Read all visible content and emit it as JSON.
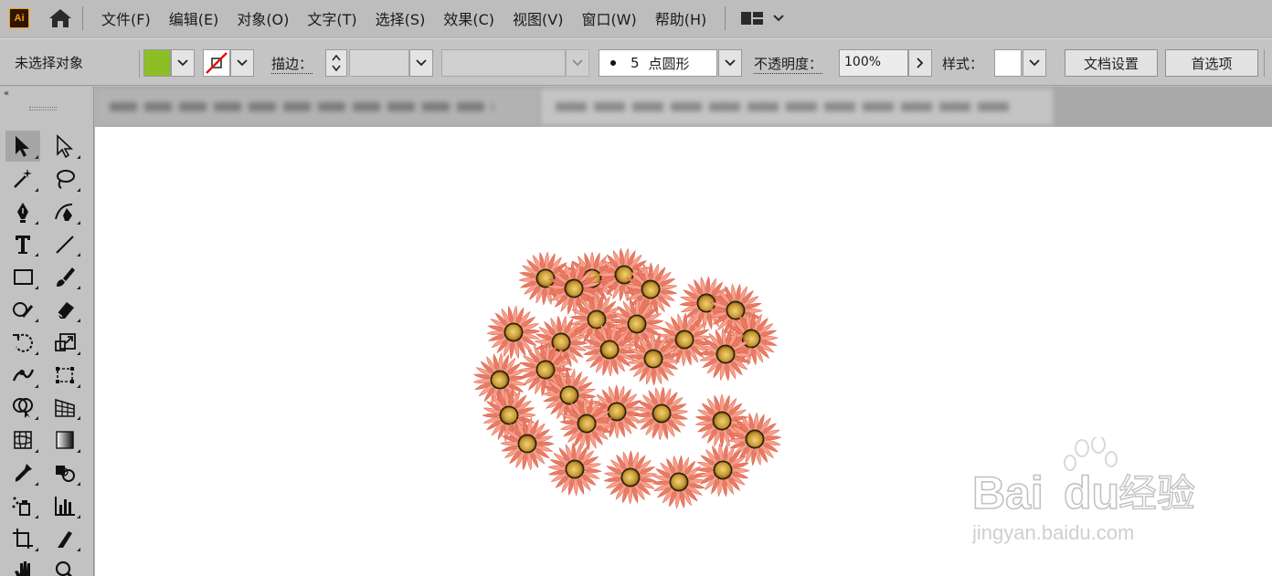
{
  "app": {
    "logo": "Ai"
  },
  "menu": [
    "文件(F)",
    "编辑(E)",
    "对象(O)",
    "文字(T)",
    "选择(S)",
    "效果(C)",
    "视图(V)",
    "窗口(W)",
    "帮助(H)"
  ],
  "control": {
    "selection_status": "未选择对象",
    "fill_color": "#8cbf26",
    "stroke_label": "描边：",
    "brush_point": "5",
    "brush_name": "点圆形",
    "opacity_label": "不透明度：",
    "opacity_value": "100%",
    "style_label": "样式：",
    "doc_setup": "文档设置",
    "preferences": "首选项"
  },
  "tools": [
    {
      "name": "selection-tool-icon",
      "icon": "arrow-solid",
      "active": true
    },
    {
      "name": "direct-selection-tool-icon",
      "icon": "arrow-hollow"
    },
    {
      "name": "magic-wand-tool-icon",
      "icon": "wand"
    },
    {
      "name": "lasso-tool-icon",
      "icon": "lasso"
    },
    {
      "name": "pen-tool-icon",
      "icon": "pen"
    },
    {
      "name": "curvature-tool-icon",
      "icon": "curvature"
    },
    {
      "name": "type-tool-icon",
      "icon": "type"
    },
    {
      "name": "line-segment-tool-icon",
      "icon": "line"
    },
    {
      "name": "rectangle-tool-icon",
      "icon": "rect"
    },
    {
      "name": "paintbrush-tool-icon",
      "icon": "brush"
    },
    {
      "name": "shaper-tool-icon",
      "icon": "shaper"
    },
    {
      "name": "eraser-tool-icon",
      "icon": "eraser"
    },
    {
      "name": "rotate-tool-icon",
      "icon": "rotate"
    },
    {
      "name": "scale-tool-icon",
      "icon": "scale"
    },
    {
      "name": "width-tool-icon",
      "icon": "width"
    },
    {
      "name": "free-transform-tool-icon",
      "icon": "freetransform"
    },
    {
      "name": "shape-builder-tool-icon",
      "icon": "shapebuilder"
    },
    {
      "name": "perspective-grid-tool-icon",
      "icon": "perspective"
    },
    {
      "name": "mesh-tool-icon",
      "icon": "mesh"
    },
    {
      "name": "gradient-tool-icon",
      "icon": "gradient"
    },
    {
      "name": "eyedropper-tool-icon",
      "icon": "eyedropper"
    },
    {
      "name": "blend-tool-icon",
      "icon": "blend"
    },
    {
      "name": "symbol-sprayer-tool-icon",
      "icon": "symbolspray"
    },
    {
      "name": "column-graph-tool-icon",
      "icon": "graph"
    },
    {
      "name": "artboard-tool-icon",
      "icon": "artboard"
    },
    {
      "name": "slice-tool-icon",
      "icon": "slice"
    },
    {
      "name": "hand-tool-icon",
      "icon": "hand"
    },
    {
      "name": "zoom-tool-icon",
      "icon": "zoom"
    }
  ],
  "colors": {
    "petal": "#ec7a62",
    "petal_light": "#f7a08c",
    "center": "#d9b14a",
    "center_ring": "#3a2b10"
  },
  "watermark": {
    "brand": "Bai",
    "brand_suffix": "经验",
    "url": "jingyan.baidu.com"
  }
}
